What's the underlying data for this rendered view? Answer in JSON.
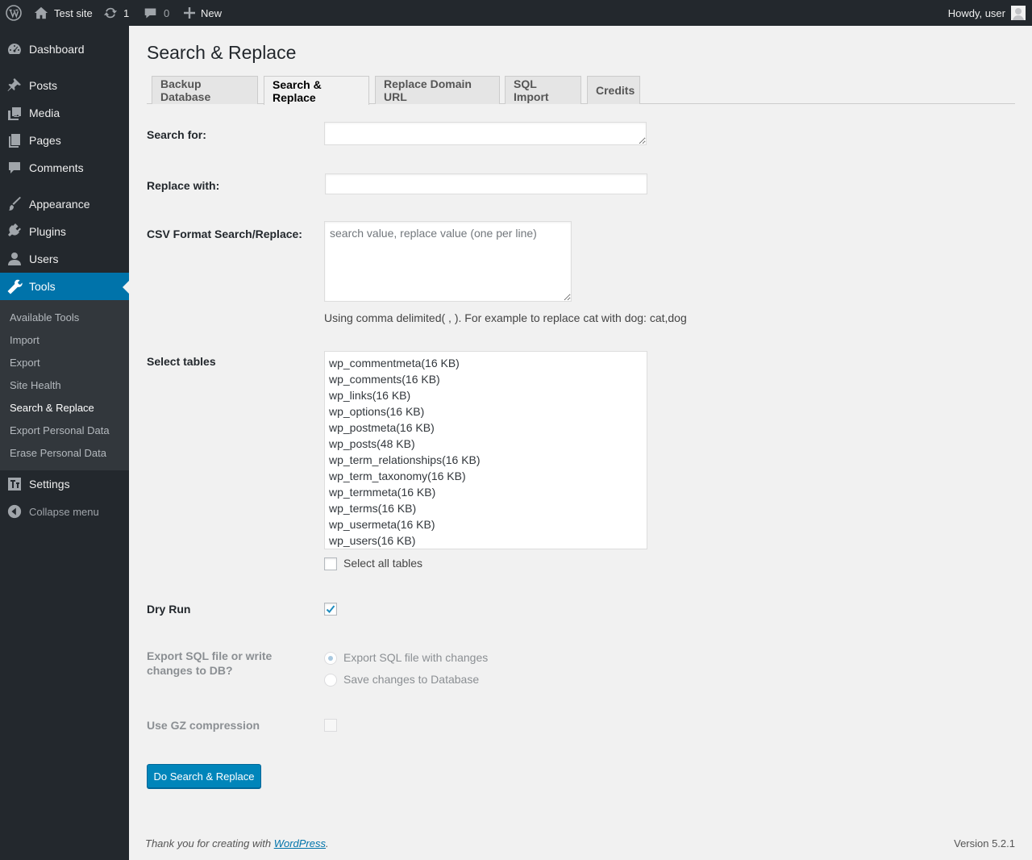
{
  "admin_bar": {
    "site_name": "Test site",
    "updates_count": "1",
    "comments_count": "0",
    "new_label": "New",
    "greeting": "Howdy, user"
  },
  "sidebar": {
    "items": [
      {
        "label": "Dashboard",
        "icon": "dashboard-icon"
      },
      {
        "label": "Posts",
        "icon": "pushpin-icon"
      },
      {
        "label": "Media",
        "icon": "media-icon"
      },
      {
        "label": "Pages",
        "icon": "pages-icon"
      },
      {
        "label": "Comments",
        "icon": "comment-icon"
      },
      {
        "label": "Appearance",
        "icon": "paintbrush-icon"
      },
      {
        "label": "Plugins",
        "icon": "plugin-icon"
      },
      {
        "label": "Users",
        "icon": "users-icon"
      },
      {
        "label": "Tools",
        "icon": "wrench-icon"
      },
      {
        "label": "Settings",
        "icon": "settings-icon"
      }
    ],
    "submenu": [
      "Available Tools",
      "Import",
      "Export",
      "Site Health",
      "Search & Replace",
      "Export Personal Data",
      "Erase Personal Data"
    ],
    "collapse_label": "Collapse menu"
  },
  "page": {
    "title": "Search & Replace",
    "tabs": [
      "Backup Database",
      "Search & Replace",
      "Replace Domain URL",
      "SQL Import",
      "Credits"
    ],
    "active_tab": "Search & Replace"
  },
  "form": {
    "search_label": "Search for:",
    "search_value": "",
    "replace_label": "Replace with:",
    "replace_value": "",
    "csv_label": "CSV Format Search/Replace:",
    "csv_placeholder": "search value, replace value (one per line)",
    "csv_hint": "Using comma delimited( , ). For example to replace cat with dog: cat,dog",
    "tables_label": "Select tables",
    "tables": [
      "wp_commentmeta(16 KB)",
      "wp_comments(16 KB)",
      "wp_links(16 KB)",
      "wp_options(16 KB)",
      "wp_postmeta(16 KB)",
      "wp_posts(48 KB)",
      "wp_term_relationships(16 KB)",
      "wp_term_taxonomy(16 KB)",
      "wp_termmeta(16 KB)",
      "wp_terms(16 KB)",
      "wp_usermeta(16 KB)",
      "wp_users(16 KB)"
    ],
    "select_all_label": "Select all tables",
    "select_all_checked": false,
    "dry_run_label": "Dry Run",
    "dry_run_checked": true,
    "export_label": "Export SQL file or write changes to DB?",
    "export_options": [
      "Export SQL file with changes",
      "Save changes to Database"
    ],
    "export_selected": "Export SQL file with changes",
    "gz_label": "Use GZ compression",
    "gz_checked": false,
    "submit_label": "Do Search & Replace"
  },
  "footer": {
    "thanks_prefix": "Thank you for creating with ",
    "thanks_link": "WordPress",
    "thanks_suffix": ".",
    "version": "Version 5.2.1"
  },
  "colors": {
    "admin_bg": "#23282d",
    "accent": "#0073aa",
    "button": "#0085ba",
    "page_bg": "#f1f1f1"
  }
}
